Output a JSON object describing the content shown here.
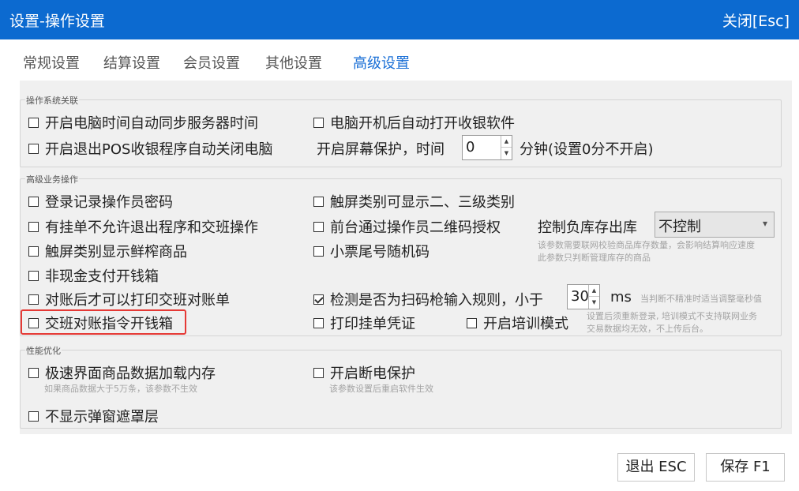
{
  "title": "设置-操作设置",
  "close_label": "关闭[Esc]",
  "tabs": [
    "常规设置",
    "结算设置",
    "会员设置",
    "其他设置",
    "高级设置"
  ],
  "active_tab": "高级设置",
  "groups": {
    "os": {
      "legend": "操作系统关联",
      "sync_time": {
        "label": "开启电脑时间自动同步服务器时间",
        "checked": false
      },
      "auto_start": {
        "label": "电脑开机后自动打开收银软件",
        "checked": false
      },
      "auto_shutdown": {
        "label": "开启退出POS收银程序自动关闭电脑",
        "checked": false
      },
      "screensaver_label": "开启屏幕保护，时间",
      "screensaver_value": "0",
      "screensaver_unit": "分钟(设置0分不开启)"
    },
    "advanced": {
      "legend": "高级业务操作",
      "login_pwd": {
        "label": "登录记录操作员密码",
        "checked": false
      },
      "touch_category": {
        "label": "触屏类别可显示二、三级类别",
        "checked": false
      },
      "pending_block": {
        "label": "有挂单不允许退出程序和交班操作",
        "checked": false
      },
      "qr_auth": {
        "label": "前台通过操作员二维码授权",
        "checked": false
      },
      "stock_label": "控制负库存出库",
      "stock_value": "不控制",
      "stock_hint": [
        "该参数需要联网校验商品库存数量，会影响结算响应速度",
        "此参数只判断管理库存的商品"
      ],
      "touch_fresh": {
        "label": "触屏类别显示鲜榨商品",
        "checked": false
      },
      "receipt_random": {
        "label": "小票尾号随机码",
        "checked": false
      },
      "noncash_drawer": {
        "label": "非现金支付开钱箱",
        "checked": false
      },
      "reconcile_print": {
        "label": "对账后才可以打印交班对账单",
        "checked": false
      },
      "scanner_detect": {
        "label": "检测是否为扫码枪输入规则，小于",
        "checked": true
      },
      "scanner_value": "30",
      "scanner_unit": "ms",
      "scanner_hint": "当判断不精准时适当调整毫秒值",
      "shift_drawer": {
        "label": "交班对账指令开钱箱",
        "checked": false
      },
      "print_pending": {
        "label": "打印挂单凭证",
        "checked": false
      },
      "training_mode": {
        "label": "开启培训模式",
        "checked": false
      },
      "training_hint": [
        "设置后须重新登录, 培训模式不支持联网业务",
        "交易数据均无效，不上传后台。"
      ]
    },
    "performance": {
      "legend": "性能优化",
      "fast_load": {
        "label": "极速界面商品数据加载内存",
        "checked": false
      },
      "fast_load_hint": "如果商品数据大于5万条，该参数不生效",
      "power_protect": {
        "label": "开启断电保护",
        "checked": false
      },
      "power_protect_hint": "该参数设置后重启软件生效",
      "no_mask": {
        "label": "不显示弹窗遮罩层",
        "checked": false
      }
    }
  },
  "buttons": {
    "exit": "退出 ESC",
    "save": "保存 F1"
  },
  "colors": {
    "titlebar": "#0c6ad0",
    "active_tab": "#1a6fd6",
    "highlight": "#e53935"
  }
}
